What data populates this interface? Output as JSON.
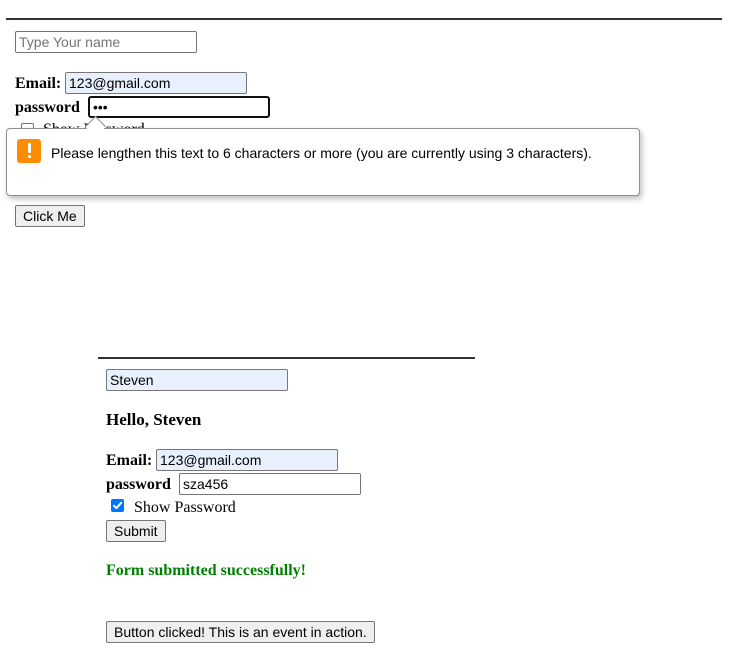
{
  "top_form": {
    "name_input": {
      "value": "",
      "placeholder": "Type Your name"
    },
    "email": {
      "label": "Email:",
      "value": "123@gmail.com"
    },
    "password": {
      "label": "password",
      "value": "•••"
    },
    "show_password": {
      "label": "Show Password",
      "checked": false
    },
    "click_button_label": "Click Me"
  },
  "validation_tooltip": {
    "icon": "warning-icon",
    "message": "Please lengthen this text to 6 characters or more (you are currently using 3 characters).",
    "accent_color": "#ff8c00"
  },
  "bottom_form": {
    "name_input": {
      "value": "Steven"
    },
    "greeting": "Hello, Steven",
    "email": {
      "label": "Email:",
      "value": "123@gmail.com"
    },
    "password": {
      "label": "password",
      "value": "sza456"
    },
    "show_password": {
      "label": "Show Password",
      "checked": true
    },
    "submit_label": "Submit",
    "success_message": "Form submitted successfully!",
    "success_color": "#008000",
    "event_button_label": "Button clicked! This is an event in action."
  }
}
